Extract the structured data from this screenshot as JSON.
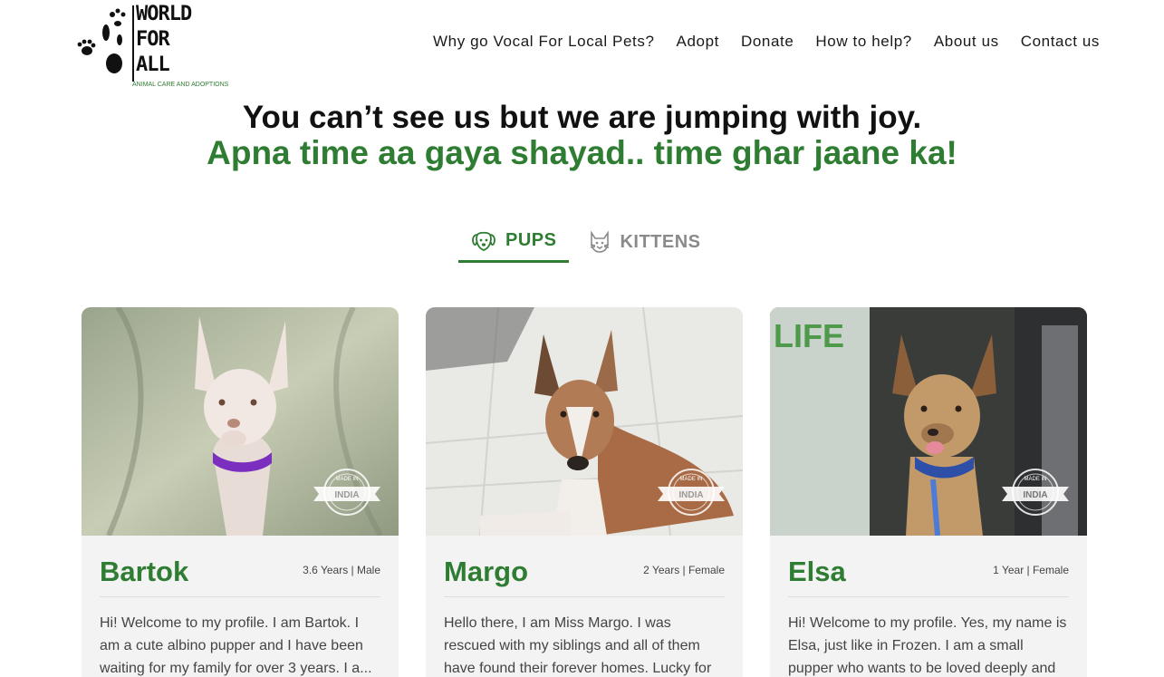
{
  "logo": {
    "word1": "WORLD",
    "word2": "FOR",
    "word3": "ALL",
    "tagline": "ANIMAL CARE AND ADOPTIONS"
  },
  "nav": {
    "items": [
      "Why go Vocal For Local Pets?",
      "Adopt",
      "Donate",
      "How to help?",
      "About us",
      "Contact us"
    ]
  },
  "hero": {
    "line1": "You can’t see us but we are jumping with joy.",
    "line2": "Apna time aa gaya shayad.. time ghar jaane ka!"
  },
  "tabs": {
    "pups": "PUPS",
    "kittens": "KITTENS",
    "active": "pups"
  },
  "badge": {
    "top": "MADE IN",
    "label": "INDIA"
  },
  "pets": [
    {
      "name": "Bartok",
      "meta": "3.6 Years | Male",
      "description": "Hi! Welcome to my profile. I am Bartok. I am a cute albino pupper and I have been waiting for my family for over 3 years. I a..."
    },
    {
      "name": "Margo",
      "meta": "2 Years | Female",
      "description": "Hello there, I am Miss Margo. I was rescued with my siblings and all of them have found their forever homes. Lucky for you, I am st..."
    },
    {
      "name": "Elsa",
      "meta": "1 Year | Female",
      "description": "Hi! Welcome to my profile. Yes, my name is Elsa, just like in Frozen. I am a small pupper who wants to be loved deeply and played..."
    }
  ],
  "colors": {
    "brand_green": "#2e7d32",
    "tab_inactive": "#8a8a8a",
    "card_bg": "#f3f3f3"
  }
}
